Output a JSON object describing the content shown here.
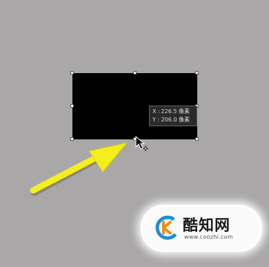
{
  "tooltip": {
    "x_label": "X :",
    "x_value": "226.5 像素",
    "y_label": "Y :",
    "y_value": "206.0 像素"
  },
  "watermark": {
    "title": "酷知网",
    "url": "www.coozhi.com"
  },
  "colors": {
    "canvas_background": "#a9a7a8",
    "shape_fill": "#000000",
    "arrow_yellow": "#f4ee1c",
    "logo_blue": "#1e8fd4",
    "logo_orange": "#f08a1c"
  },
  "icons": {
    "cursor": "move-cursor-icon",
    "arrow": "pointer-arrow-icon",
    "logo": "coozhi-logo-icon"
  }
}
